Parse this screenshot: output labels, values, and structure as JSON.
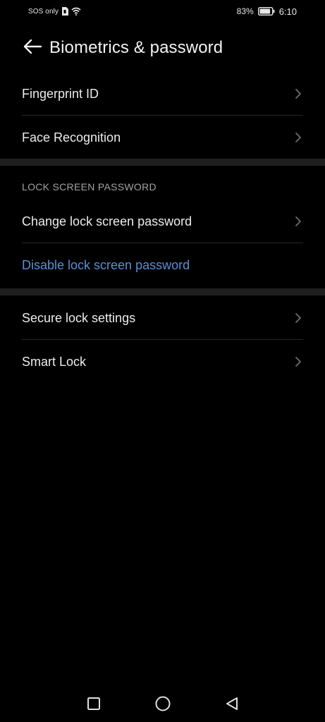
{
  "status_bar": {
    "carrier": "SOS only",
    "battery_percent": "83%",
    "time": "6:10",
    "icons": [
      "sim-icon",
      "wifi-icon",
      "battery-icon"
    ]
  },
  "header": {
    "back_icon": "back-arrow-icon",
    "title": "Biometrics & password"
  },
  "group1": {
    "items": [
      {
        "label": "Fingerprint ID",
        "icon": "chevron-right-icon"
      },
      {
        "label": "Face Recognition",
        "icon": "chevron-right-icon"
      }
    ]
  },
  "lock_section": {
    "header": "LOCK SCREEN PASSWORD",
    "items": [
      {
        "label": "Change lock screen password",
        "icon": "chevron-right-icon"
      },
      {
        "label": "Disable lock screen password",
        "color": "#5b8fd6"
      }
    ]
  },
  "group3": {
    "items": [
      {
        "label": "Secure lock settings",
        "icon": "chevron-right-icon"
      },
      {
        "label": "Smart Lock",
        "icon": "chevron-right-icon"
      }
    ]
  },
  "nav_bar": {
    "buttons": [
      "recents-square-icon",
      "home-circle-icon",
      "back-triangle-icon"
    ]
  },
  "colors": {
    "background": "#000000",
    "text": "#ececec",
    "link": "#5b8fd6",
    "section_header": "#a3a3a3",
    "gap": "#1f1f1f"
  }
}
